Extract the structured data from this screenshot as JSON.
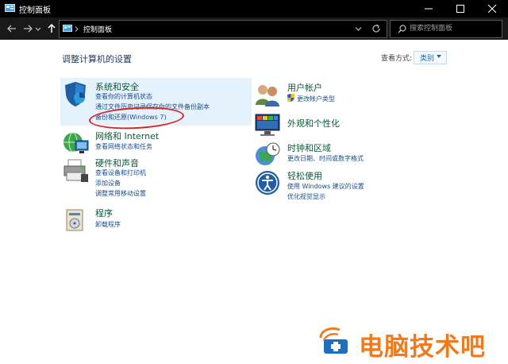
{
  "window": {
    "title": "控制面板",
    "minimize_glyph": "—",
    "maximize_glyph": "☐",
    "close_glyph": "✕"
  },
  "address": {
    "path": "控制面板",
    "search_placeholder": "搜索控制面板"
  },
  "main": {
    "heading": "调整计算机的设置",
    "view_by_label": "查看方式:",
    "view_by_value": "类别"
  },
  "categories": {
    "system": {
      "title": "系统和安全",
      "links": [
        "查看你的计算机状态",
        "通过文件历史记录保存你的文件备份副本",
        "备份和还原(Windows 7)"
      ]
    },
    "network": {
      "title": "网络和 Internet",
      "links": [
        "查看网络状态和任务"
      ]
    },
    "hardware": {
      "title": "硬件和声音",
      "links": [
        "查看设备和打印机",
        "添加设备",
        "调整常用移动设置"
      ]
    },
    "programs": {
      "title": "程序",
      "links": [
        "卸载程序"
      ]
    },
    "user_accounts": {
      "title": "用户帐户",
      "links": [
        "更改帐户类型"
      ]
    },
    "appearance": {
      "title": "外观和个性化",
      "links": []
    },
    "clock": {
      "title": "时钟和区域",
      "links": [
        "更改日期、时间或数字格式"
      ]
    },
    "ease": {
      "title": "轻松使用",
      "links": [
        "使用 Windows 建议的设置",
        "优化视觉显示"
      ]
    }
  },
  "watermark": {
    "text": "电脑技术吧"
  },
  "colors": {
    "accent": "#1e6aa8",
    "category_title": "#0a5a38",
    "link": "#1a4d8a",
    "annotation": "#d0282a",
    "watermark": "#f07a1d"
  }
}
